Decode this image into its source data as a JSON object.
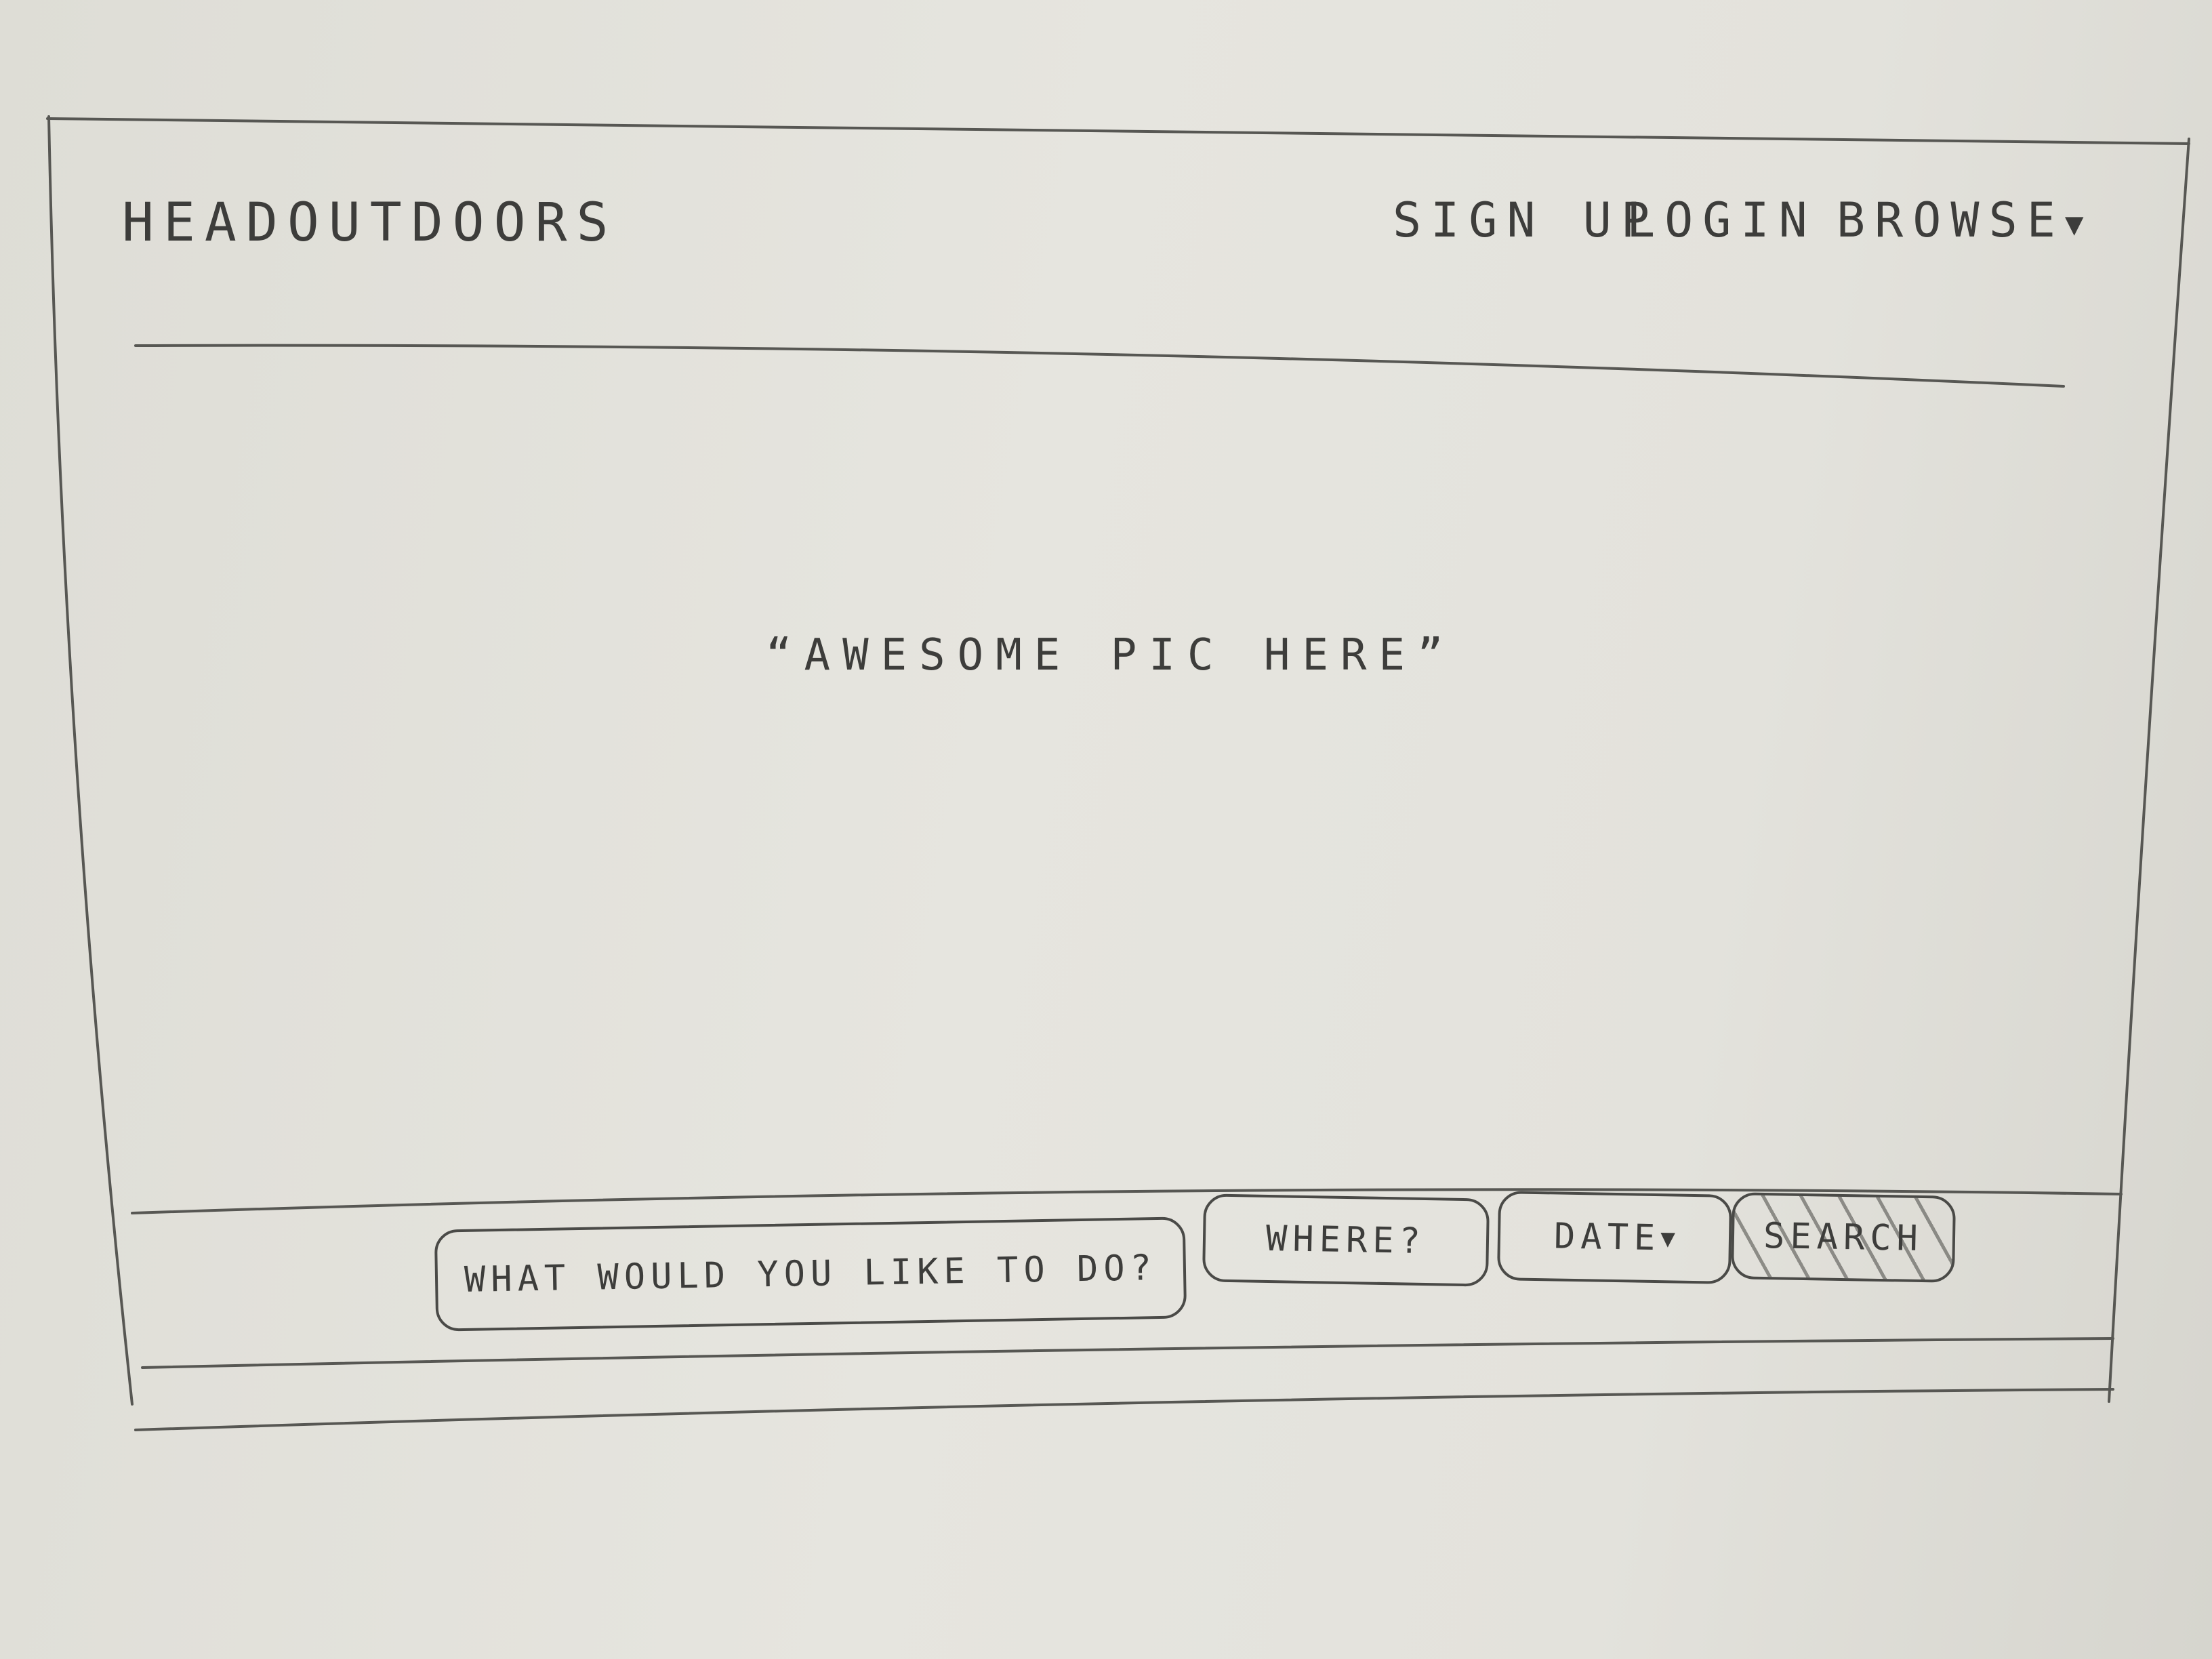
{
  "header": {
    "brand": "HEADOUTDOORS",
    "nav": {
      "signup": "SIGN UP",
      "login": "LOGIN",
      "browse": "BROWSE"
    }
  },
  "hero": {
    "placeholder_text": "“AWESOME PIC HERE”"
  },
  "search_bar": {
    "what_placeholder": "WHAT WOULD YOU LIKE TO DO?",
    "where_placeholder": "WHERE?",
    "date_label": "DATE",
    "search_label": "SEARCH"
  },
  "icons": {
    "browse_caret": "chevron-down-icon",
    "date_caret": "chevron-down-icon"
  },
  "colors": {
    "paper": "#e3e2dc",
    "pencil": "#3d3d3b"
  }
}
